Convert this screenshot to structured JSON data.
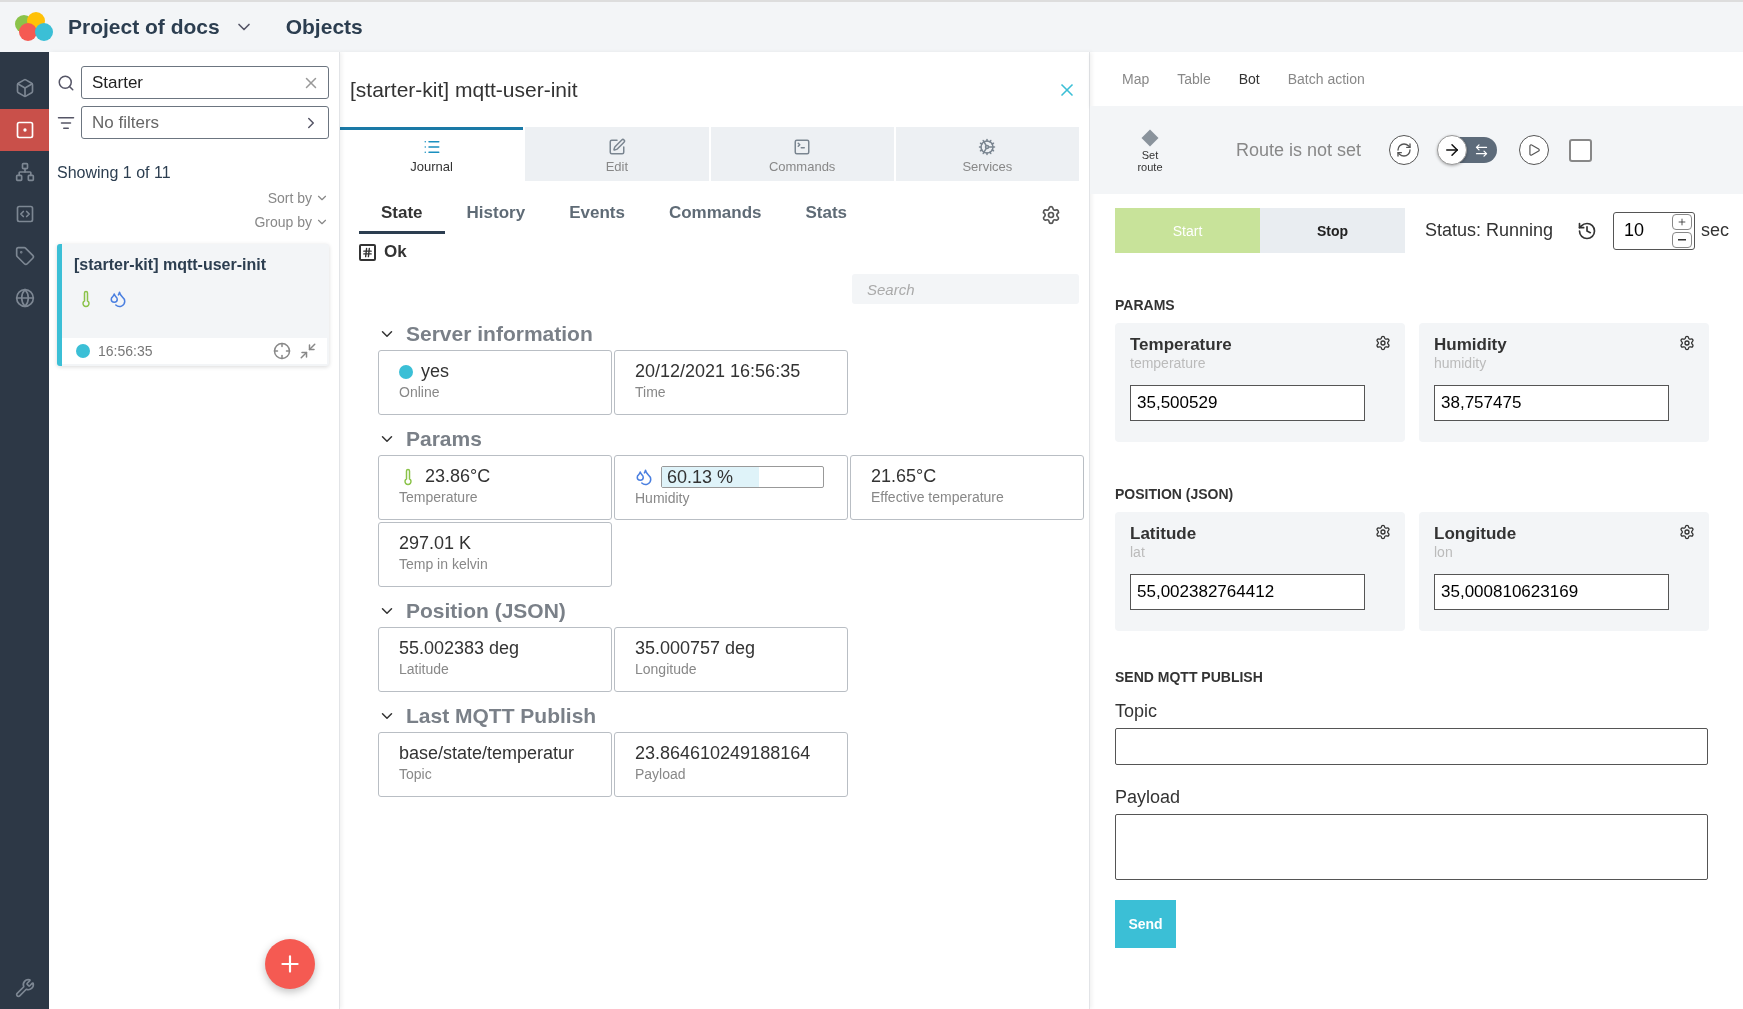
{
  "header": {
    "project": "Project of docs",
    "section": "Objects"
  },
  "rail": {
    "items": [
      {
        "selected": false
      },
      {
        "selected": true
      },
      {
        "selected": false
      },
      {
        "selected": false
      },
      {
        "selected": false
      },
      {
        "selected": false
      }
    ]
  },
  "list": {
    "search": {
      "value": "Starter"
    },
    "filter": {
      "value": "No filters"
    },
    "showing": "Showing 1 of 11",
    "sort": "Sort by",
    "group": "Group by",
    "cards": [
      {
        "title": "[starter-kit] mqtt-user-init",
        "time": "16:56:35",
        "online": true,
        "selected": true
      }
    ]
  },
  "detail": {
    "title": "[starter-kit] mqtt-user-init",
    "tabs": [
      {
        "label": "Journal",
        "selected": true
      },
      {
        "label": "Edit",
        "selected": false
      },
      {
        "label": "Commands",
        "selected": false
      },
      {
        "label": "Services",
        "selected": false
      }
    ],
    "subtabs": [
      {
        "label": "State",
        "selected": true
      },
      {
        "label": "History",
        "selected": false
      },
      {
        "label": "Events",
        "selected": false
      },
      {
        "label": "Commands",
        "selected": false
      },
      {
        "label": "Stats",
        "selected": false
      }
    ],
    "status": "Ok",
    "search": {
      "placeholder": "Search"
    },
    "sections": [
      {
        "title": "Server information",
        "expanded": true,
        "cells": [
          {
            "kind": "status",
            "value": "yes",
            "label": "Online",
            "online": true
          },
          {
            "kind": "plain",
            "value": "20/12/2021 16:56:35",
            "label": "Time"
          }
        ]
      },
      {
        "title": "Params",
        "expanded": true,
        "cells": [
          {
            "kind": "thermo",
            "value": "23.86°C",
            "label": "Temperature"
          },
          {
            "kind": "meter",
            "value": "60.13 %",
            "label": "Humidity",
            "level": 0.6013
          },
          {
            "kind": "plain",
            "value": "21.65°C",
            "label": "Effective temperature"
          },
          {
            "kind": "plain",
            "value": "297.01 K",
            "label": "Temp in kelvin"
          }
        ]
      },
      {
        "title": "Position (JSON)",
        "expanded": true,
        "cells": [
          {
            "kind": "plain",
            "value": "55.002383 deg",
            "label": "Latitude"
          },
          {
            "kind": "plain",
            "value": "35.000757 deg",
            "label": "Longitude"
          }
        ]
      },
      {
        "title": "Last MQTT Publish",
        "expanded": true,
        "cells": [
          {
            "kind": "plain",
            "value": "base/state/temperatur",
            "label": "Topic"
          },
          {
            "kind": "plain",
            "value": "23.864610249188164",
            "label": "Payload"
          }
        ]
      }
    ]
  },
  "bot": {
    "tabs": [
      {
        "label": "Map",
        "selected": false
      },
      {
        "label": "Table",
        "selected": false
      },
      {
        "label": "Bot",
        "selected": true
      },
      {
        "label": "Batch action",
        "selected": false
      }
    ],
    "route": {
      "button": "Set route",
      "text": "Route is not set",
      "mode_on": false,
      "checked": false
    },
    "run": {
      "start": "Start",
      "stop": "Stop",
      "running": true,
      "status": "Status: Running",
      "interval": "10",
      "unit": "sec"
    },
    "groups": [
      {
        "title": "PARAMS",
        "params": [
          {
            "name": "Temperature",
            "key": "temperature",
            "value": "35,500529"
          },
          {
            "name": "Humidity",
            "key": "humidity",
            "value": "38,757475"
          }
        ]
      },
      {
        "title": "POSITION (JSON)",
        "params": [
          {
            "name": "Latitude",
            "key": "lat",
            "value": "55,002382764412"
          },
          {
            "name": "Longitude",
            "key": "lon",
            "value": "35,000810623169"
          }
        ]
      }
    ],
    "mqtt": {
      "title": "SEND MQTT PUBLISH",
      "topic_label": "Topic",
      "payload_label": "Payload",
      "send": "Send"
    }
  }
}
